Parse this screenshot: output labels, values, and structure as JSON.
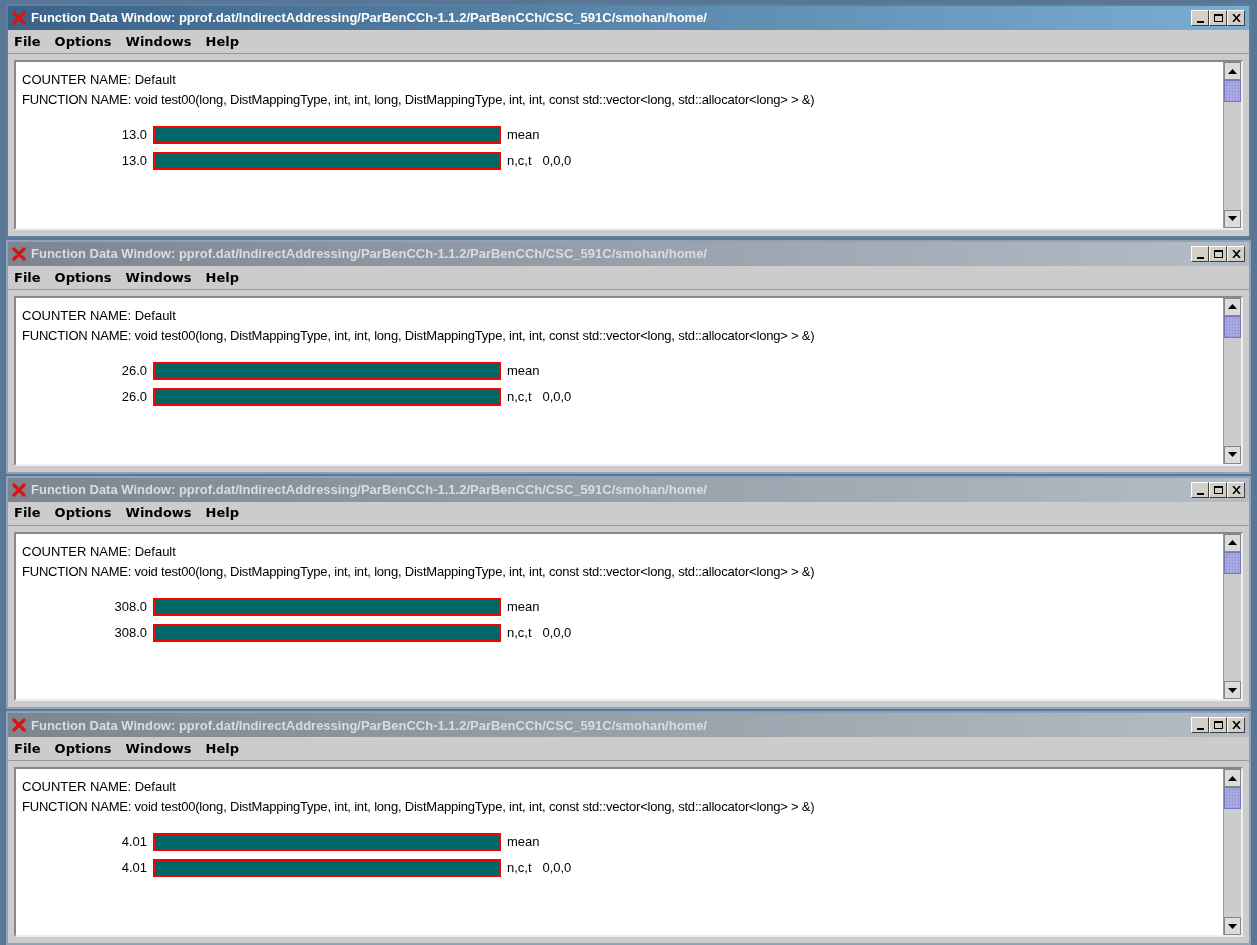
{
  "windows": [
    {
      "title": "Function Data Window: pprof.dat/IndirectAddressing/ParBenCCh-1.1.2/ParBenCCh/CSC_591C/smohan/home/",
      "active": true,
      "menu": [
        "File",
        "Options",
        "Windows",
        "Help"
      ],
      "counter_name": "COUNTER NAME: Default",
      "function_name": "FUNCTION NAME: void test00(long, DistMappingType, int, int, long, DistMappingType, int, int, const std::vector<long, std::allocator<long> > &)",
      "rows": [
        {
          "value": "13.0",
          "label": "mean"
        },
        {
          "value": "13.0",
          "label": "n,c,t   0,0,0"
        }
      ]
    },
    {
      "title": "Function Data Window: pprof.dat/IndirectAddressing/ParBenCCh-1.1.2/ParBenCCh/CSC_591C/smohan/home/",
      "active": false,
      "menu": [
        "File",
        "Options",
        "Windows",
        "Help"
      ],
      "counter_name": "COUNTER NAME: Default",
      "function_name": "FUNCTION NAME: void test00(long, DistMappingType, int, int, long, DistMappingType, int, int, const std::vector<long, std::allocator<long> > &)",
      "rows": [
        {
          "value": "26.0",
          "label": "mean"
        },
        {
          "value": "26.0",
          "label": "n,c,t   0,0,0"
        }
      ]
    },
    {
      "title": "Function Data Window: pprof.dat/IndirectAddressing/ParBenCCh-1.1.2/ParBenCCh/CSC_591C/smohan/home/",
      "active": false,
      "menu": [
        "File",
        "Options",
        "Windows",
        "Help"
      ],
      "counter_name": "COUNTER NAME: Default",
      "function_name": "FUNCTION NAME: void test00(long, DistMappingType, int, int, long, DistMappingType, int, int, const std::vector<long, std::allocator<long> > &)",
      "rows": [
        {
          "value": "308.0",
          "label": "mean"
        },
        {
          "value": "308.0",
          "label": "n,c,t   0,0,0"
        }
      ]
    },
    {
      "title": "Function Data Window: pprof.dat/IndirectAddressing/ParBenCCh-1.1.2/ParBenCCh/CSC_591C/smohan/home/",
      "active": false,
      "menu": [
        "File",
        "Options",
        "Windows",
        "Help"
      ],
      "counter_name": "COUNTER NAME: Default",
      "function_name": "FUNCTION NAME: void test00(long, DistMappingType, int, int, long, DistMappingType, int, int, const std::vector<long, std::allocator<long> > &)",
      "rows": [
        {
          "value": "4.01",
          "label": "mean"
        },
        {
          "value": "4.01",
          "label": "n,c,t   0,0,0"
        }
      ]
    }
  ]
}
